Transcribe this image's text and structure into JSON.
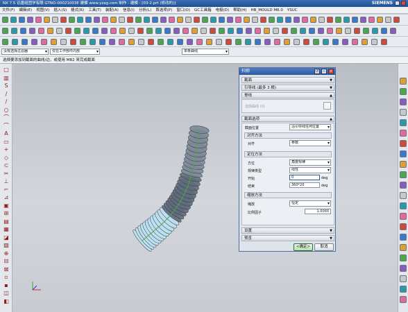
{
  "window": {
    "title": "NX 7.5 讥唐组团学有限 GTNO-00021003E 建模 www.yzag.com 制作 - 建模 - [03-2.prt (修改的)]",
    "brand": "SIEMENS"
  },
  "menu": [
    "文件(F)",
    "编辑(E)",
    "视图(V)",
    "插入(S)",
    "格式(R)",
    "工具(T)",
    "装配(A)",
    "信息(I)",
    "分析(L)",
    "首选项(P)",
    "窗口(O)",
    "GC工具箱",
    "电极(D)",
    "帮助(H)",
    "HB_MOULD M6.0",
    "YSUC"
  ],
  "selectbar": {
    "filter": "没有选择过滤器",
    "scope": "仅在工作部件内部",
    "snap": "单条曲线"
  },
  "cue_line": "选择要添加到截面的曲线/边，或使用 MB2 来完成截面",
  "dialog": {
    "title": "扫掠",
    "sections": {
      "section": "截面",
      "guide": "引导线 (最多 3 根)",
      "spine": "脊线",
      "spine_select": "选择曲线 (0)",
      "section_options": "截面选项",
      "settings": "设置",
      "preview": "预览"
    },
    "section_location_label": "截面位置",
    "section_location_value": "沿引导线任何位置",
    "alignment_group": "对齐方法",
    "alignment_label": "对齐",
    "alignment_value": "参数",
    "orientation_group": "定位方法",
    "direction_label": "方位",
    "direction_value": "角度规律",
    "law_type_label": "规律类型",
    "law_type_value": "线性",
    "start_label": "开始",
    "start_value": "0",
    "end_label": "结束",
    "end_value": "360*20",
    "unit": "deg",
    "scaling_group": "缩放方法",
    "scale_label": "缩放",
    "scale_value": "恒定",
    "factor_label": "比例因子",
    "factor_value": "1.0000",
    "ok": "<确定>",
    "cancel": "取消"
  },
  "colors": {
    "accent": "#2c5a9e",
    "viewport": "#c9cdd3"
  }
}
